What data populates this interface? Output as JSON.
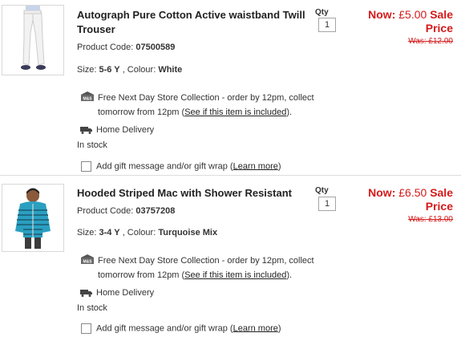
{
  "items": [
    {
      "title": "Autograph Pure Cotton Active waistband Twill Trouser",
      "code_label": "Product Code:",
      "code": "07500589",
      "size_label": "Size:",
      "size": "5-6 Y",
      "colour_label": ", Colour:",
      "colour": "White",
      "collection_line1": "Free Next Day Store Collection - order by 12pm, collect",
      "collection_line2": "tomorrow  from 12pm (",
      "collection_link": "See if this item is included",
      "collection_end": ").",
      "delivery": "Home Delivery",
      "stock": "In stock",
      "gift_text": "Add gift message and/or gift wrap (",
      "gift_link": "Learn more",
      "gift_end": ")",
      "qty_label": "Qty",
      "qty_value": "1",
      "now_label": "Now:",
      "now_price": "£5.00",
      "sale_label": "Sale Price",
      "was": "Was: £12.00"
    },
    {
      "title": "Hooded Striped Mac with Shower Resistant",
      "code_label": "Product Code:",
      "code": "03757208",
      "size_label": "Size:",
      "size": "3-4 Y",
      "colour_label": ", Colour:",
      "colour": "Turquoise Mix",
      "collection_line1": "Free Next Day Store Collection - order by 12pm, collect",
      "collection_line2": "tomorrow  from 12pm (",
      "collection_link": "See if this item is included",
      "collection_end": ").",
      "delivery": "Home Delivery",
      "stock": "In stock",
      "gift_text": "Add gift message and/or gift wrap (",
      "gift_link": "Learn more",
      "gift_end": ")",
      "qty_label": "Qty",
      "qty_value": "1",
      "now_label": "Now:",
      "now_price": "£6.50",
      "sale_label": "Sale Price",
      "was": "Was: £13.00"
    }
  ],
  "icons": {
    "store": "store-collection-icon",
    "delivery": "delivery-truck-icon",
    "checkbox": "gift-checkbox"
  },
  "colors": {
    "price_red": "#d41a1a",
    "jacket_turquoise": "#2a9fc0"
  }
}
